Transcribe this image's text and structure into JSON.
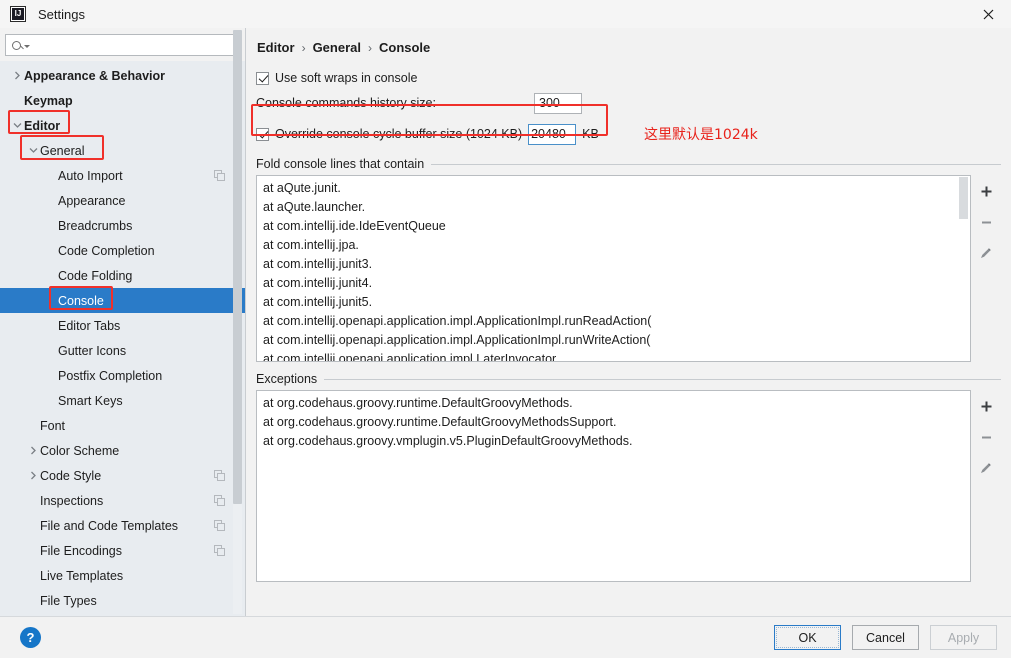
{
  "window": {
    "title": "Settings",
    "logo_icon": "intellij-idea-logo",
    "close_icon": "close-icon"
  },
  "search": {
    "value": "",
    "placeholder": "",
    "icon": "search-icon",
    "dropdown_icon": "chevron-down-icon"
  },
  "sidebar": {
    "scrollbar": "vertical-scrollbar",
    "items": [
      {
        "label": "Appearance & Behavior",
        "level": "lvl0",
        "twisty": "chevron-right-icon",
        "selected": false,
        "copy": false
      },
      {
        "label": "Keymap",
        "level": "lvl0b",
        "twisty": "none",
        "selected": false,
        "copy": false
      },
      {
        "label": "Editor",
        "level": "lvl0",
        "twisty": "chevron-down-icon",
        "selected": false,
        "copy": false
      },
      {
        "label": "General",
        "level": "lvl1",
        "twisty": "chevron-down-icon",
        "selected": false,
        "copy": false
      },
      {
        "label": "Auto Import",
        "level": "lvl2",
        "twisty": "none",
        "selected": false,
        "copy": true
      },
      {
        "label": "Appearance",
        "level": "lvl2",
        "twisty": "none",
        "selected": false,
        "copy": false
      },
      {
        "label": "Breadcrumbs",
        "level": "lvl2",
        "twisty": "none",
        "selected": false,
        "copy": false
      },
      {
        "label": "Code Completion",
        "level": "lvl2",
        "twisty": "none",
        "selected": false,
        "copy": false
      },
      {
        "label": "Code Folding",
        "level": "lvl2",
        "twisty": "none",
        "selected": false,
        "copy": false
      },
      {
        "label": "Console",
        "level": "lvl2",
        "twisty": "none",
        "selected": true,
        "copy": false
      },
      {
        "label": "Editor Tabs",
        "level": "lvl2",
        "twisty": "none",
        "selected": false,
        "copy": false
      },
      {
        "label": "Gutter Icons",
        "level": "lvl2",
        "twisty": "none",
        "selected": false,
        "copy": false
      },
      {
        "label": "Postfix Completion",
        "level": "lvl2",
        "twisty": "none",
        "selected": false,
        "copy": false
      },
      {
        "label": "Smart Keys",
        "level": "lvl2",
        "twisty": "none",
        "selected": false,
        "copy": false
      },
      {
        "label": "Font",
        "level": "lvl1b",
        "twisty": "none",
        "selected": false,
        "copy": false
      },
      {
        "label": "Color Scheme",
        "level": "lvl1",
        "twisty": "chevron-right-icon",
        "selected": false,
        "copy": false
      },
      {
        "label": "Code Style",
        "level": "lvl1",
        "twisty": "chevron-right-icon",
        "selected": false,
        "copy": true
      },
      {
        "label": "Inspections",
        "level": "lvl1b",
        "twisty": "none",
        "selected": false,
        "copy": true
      },
      {
        "label": "File and Code Templates",
        "level": "lvl1b",
        "twisty": "none",
        "selected": false,
        "copy": true
      },
      {
        "label": "File Encodings",
        "level": "lvl1b",
        "twisty": "none",
        "selected": false,
        "copy": true
      },
      {
        "label": "Live Templates",
        "level": "lvl1b",
        "twisty": "none",
        "selected": false,
        "copy": false
      },
      {
        "label": "File Types",
        "level": "lvl1b",
        "twisty": "none",
        "selected": false,
        "copy": false
      }
    ]
  },
  "main": {
    "breadcrumb": {
      "part1": "Editor",
      "sep1": "›",
      "part2": "General",
      "sep2": "›",
      "part3": "Console"
    },
    "soft_wraps": {
      "label": "Use soft wraps in console",
      "checked": true
    },
    "history_size": {
      "label": "Console commands history size:",
      "value": "300"
    },
    "override_buffer": {
      "label": "Override console cycle buffer size (1024 KB)",
      "checked": true,
      "value": "20480",
      "unit": "KB"
    },
    "annotation_note": "这里默认是1024k",
    "annotation_color": "#f0302a",
    "fold_group": {
      "title": "Fold console lines that contain",
      "lines": [
        "at aQute.junit.",
        "at aQute.launcher.",
        "at com.intellij.ide.IdeEventQueue",
        "at com.intellij.jpa.",
        "at com.intellij.junit3.",
        "at com.intellij.junit4.",
        "at com.intellij.junit5.",
        "at com.intellij.openapi.application.impl.ApplicationImpl.runReadAction(",
        "at com.intellij.openapi.application.impl.ApplicationImpl.runWriteAction(",
        "at com.intellij.openapi.application.impl.LaterInvocator"
      ],
      "buttons": [
        {
          "icon": "plus-icon",
          "name": "add-fold-pattern-button"
        },
        {
          "icon": "minus-icon",
          "name": "remove-fold-pattern-button"
        },
        {
          "icon": "pencil-icon",
          "name": "edit-fold-pattern-button"
        }
      ]
    },
    "exceptions_group": {
      "title": "Exceptions",
      "lines": [
        "at org.codehaus.groovy.runtime.DefaultGroovyMethods.",
        "at org.codehaus.groovy.runtime.DefaultGroovyMethodsSupport.",
        "at org.codehaus.groovy.vmplugin.v5.PluginDefaultGroovyMethods."
      ],
      "buttons": [
        {
          "icon": "plus-icon",
          "name": "add-exception-pattern-button"
        },
        {
          "icon": "minus-icon",
          "name": "remove-exception-pattern-button"
        },
        {
          "icon": "pencil-icon",
          "name": "edit-exception-pattern-button"
        }
      ]
    }
  },
  "footer": {
    "help_label": "?",
    "ok": "OK",
    "cancel": "Cancel",
    "apply": "Apply",
    "apply_disabled": true
  },
  "colors": {
    "selection_blue": "#2a7bc8",
    "annotation_red": "#f0302a",
    "help_blue": "#1676c8",
    "sidebar_bg": "#e8ecf0",
    "panel_bg": "#f2f2f2"
  }
}
